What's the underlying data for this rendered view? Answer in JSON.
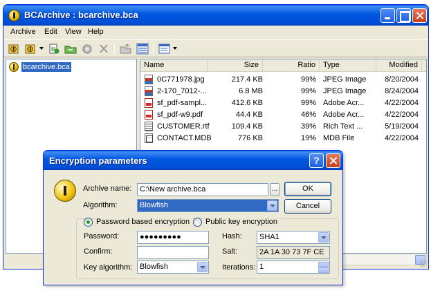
{
  "window": {
    "title": "BCArchive : bcarchive.bca"
  },
  "menu": [
    "Archive",
    "Edit",
    "View",
    "Help"
  ],
  "tree": {
    "root_label": "bcarchive.bca"
  },
  "list": {
    "columns": [
      "Name",
      "Size",
      "Ratio",
      "Type",
      "Modified"
    ],
    "rows": [
      {
        "icon": "jpg",
        "name": "0C771978.jpg",
        "size": "217.4 KB",
        "ratio": "99%",
        "type": "JPEG Image",
        "modified": "8/20/2004"
      },
      {
        "icon": "jpg",
        "name": "2-170_7012-...",
        "size": "6.8 MB",
        "ratio": "99%",
        "type": "JPEG Image",
        "modified": "8/24/2004"
      },
      {
        "icon": "pdf",
        "name": "sf_pdf-sampl...",
        "size": "412.6 KB",
        "ratio": "99%",
        "type": "Adobe Acr...",
        "modified": "4/22/2004"
      },
      {
        "icon": "pdf",
        "name": "sf_pdf-w9.pdf",
        "size": "44.4 KB",
        "ratio": "46%",
        "type": "Adobe Acr...",
        "modified": "4/22/2004"
      },
      {
        "icon": "rtf",
        "name": "CUSTOMER.rtf",
        "size": "109.4 KB",
        "ratio": "39%",
        "type": "Rich Text ...",
        "modified": "5/19/2004"
      },
      {
        "icon": "mdb",
        "name": "CONTACT.MDB",
        "size": "776 KB",
        "ratio": "19%",
        "type": "MDB File",
        "modified": "4/22/2004"
      }
    ]
  },
  "dialog": {
    "title": "Encryption parameters",
    "help_glyph": "?",
    "archive_name_label": "Archive name:",
    "archive_name_value": "C:\\New archive.bca",
    "browse_label": "...",
    "algorithm_label": "Algorithm:",
    "algorithm_value": "Blowfish",
    "ok_label": "OK",
    "cancel_label": "Cancel",
    "radio_password": "Password based encryption",
    "radio_public": "Public key encryption",
    "password_label": "Password:",
    "password_value": "●●●●●●●●●",
    "confirm_label": "Confirm:",
    "confirm_value": "",
    "key_algorithm_label": "Key algorithm:",
    "key_algorithm_value": "Blowfish",
    "hash_label": "Hash:",
    "hash_value": "SHA1",
    "salt_label": "Salt:",
    "salt_value": "2A 1A 30 73 7F CE",
    "iterations_label": "Iterations:",
    "iterations_value": "1",
    "selected_mode": "password"
  },
  "colors": {
    "titlebar": "#0054e3",
    "selection": "#316ac5",
    "window_bg": "#ece9d8"
  },
  "icons": [
    "archive-icon",
    "open-icon",
    "add-files-icon",
    "extract-icon",
    "test-icon",
    "delete-icon",
    "up-folder-icon",
    "details-view-icon",
    "view-mode-icon"
  ]
}
